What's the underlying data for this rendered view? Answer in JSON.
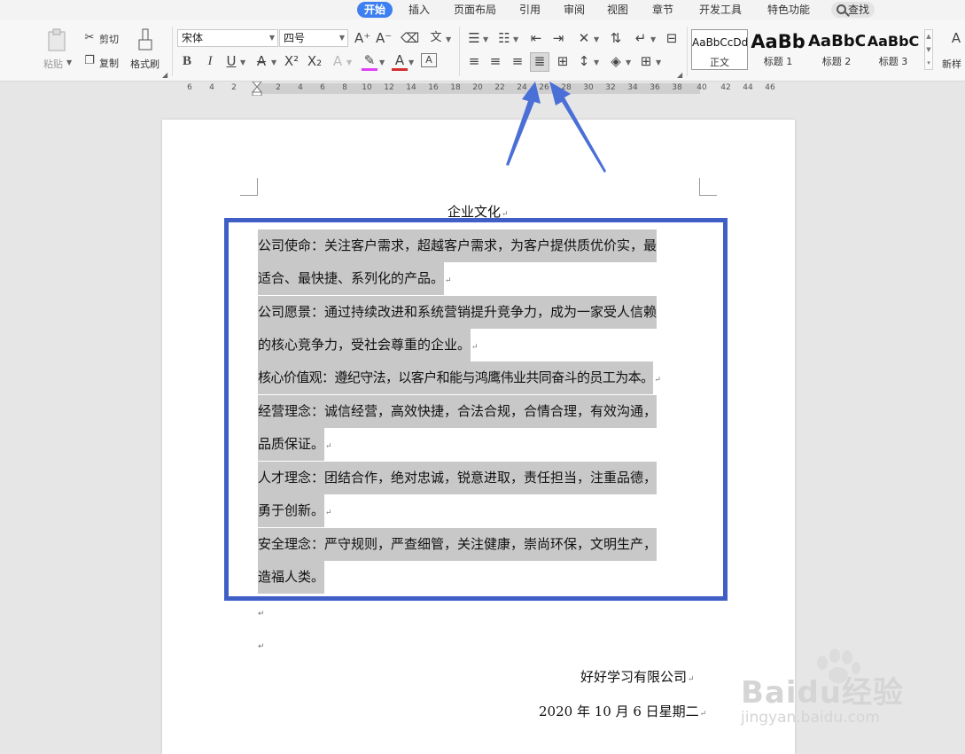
{
  "tabs": [
    {
      "label": "开始",
      "active": true
    },
    {
      "label": "插入"
    },
    {
      "label": "页面布局"
    },
    {
      "label": "引用"
    },
    {
      "label": "审阅"
    },
    {
      "label": "视图"
    },
    {
      "label": "章节"
    },
    {
      "label": "开发工具"
    },
    {
      "label": "特色功能"
    }
  ],
  "search": {
    "label": "查找"
  },
  "ribbon": {
    "paste_label": "粘贴",
    "cut_label": "剪切",
    "copy_label": "复制",
    "format_painter_label": "格式刷",
    "font_name": "宋体",
    "font_size": "四号",
    "styles": [
      {
        "sample": "AaBbCcDd",
        "name": "正文",
        "selected": true
      },
      {
        "sample": "AaBb",
        "name": "标题 1"
      },
      {
        "sample": "AaBbC",
        "name": "标题 2"
      },
      {
        "sample": "AaBbC",
        "name": "标题 3"
      }
    ],
    "new_style_label": "新样"
  },
  "ruler": {
    "ticks": [
      "6",
      "4",
      "2",
      "2",
      "4",
      "6",
      "8",
      "10",
      "12",
      "14",
      "16",
      "18",
      "20",
      "22",
      "24",
      "26",
      "28",
      "30",
      "32",
      "34",
      "36",
      "38",
      "40",
      "42",
      "44",
      "46"
    ]
  },
  "document": {
    "title": "企业文化",
    "paragraphs": [
      {
        "lines": [
          "公司使命：关注客户需求，超越客户需求，为客户提供质优价实，最",
          "适合、最快捷、系列化的产品。"
        ]
      },
      {
        "lines": [
          "公司愿景：通过持续改进和系统营销提升竞争力，成为一家受人信赖",
          "的核心竞争力，受社会尊重的企业。"
        ]
      },
      {
        "lines": [
          "核心价值观：遵纪守法，以客户和能与鸿鹰伟业共同奋斗的员工为本。"
        ]
      },
      {
        "lines": [
          "经营理念：诚信经营，高效快捷，合法合规，合情合理，有效沟通，",
          "品质保证。"
        ]
      },
      {
        "lines": [
          "人才理念：团结合作，绝对忠诚，锐意进取，责任担当，注重品德，",
          "勇于创新。"
        ]
      },
      {
        "lines": [
          "安全理念：严守规则，严查细管，关注健康，崇尚环保，文明生产，",
          "造福人类。"
        ]
      }
    ],
    "company": "好好学习有限公司",
    "date": "2020 年 10 月 6 日星期二"
  },
  "watermark": {
    "brand": "Baidu经验",
    "sub": "jingyan.baidu.com"
  },
  "colors": {
    "accent": "#3d7ff0",
    "highlight_box": "#3f5fc7",
    "arrow": "#4a6fd6",
    "selection": "#c8c8c8"
  }
}
